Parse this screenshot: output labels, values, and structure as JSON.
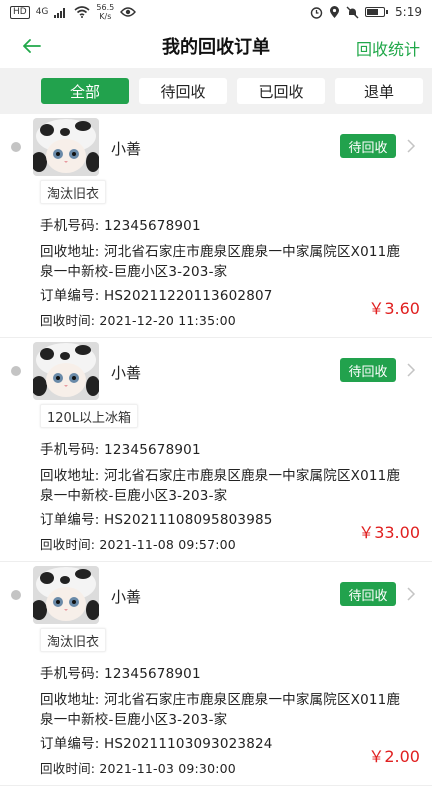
{
  "status_bar": {
    "hd": "HD",
    "signal": "4G",
    "speed_value": "56.5",
    "speed_unit": "K/s",
    "time": "5:19"
  },
  "header": {
    "title": "我的回收订单",
    "stats_label": "回收统计"
  },
  "tabs": [
    {
      "label": "全部",
      "active": true
    },
    {
      "label": "待回收",
      "active": false
    },
    {
      "label": "已回收",
      "active": false
    },
    {
      "label": "退单",
      "active": false
    }
  ],
  "labels": {
    "phone": "手机号码: ",
    "address": "回收地址: ",
    "order_no": "订单编号: ",
    "time": "回收时间: "
  },
  "orders": [
    {
      "username": "小善",
      "status": "待回收",
      "item": "淘汰旧衣",
      "phone": "12345678901",
      "address": "河北省石家庄市鹿泉区鹿泉一中家属院区X011鹿泉一中新校-巨鹿小区3-203-家",
      "order_no": "HS20211220113602807",
      "time": "2021-12-20 11:35:00",
      "amount": "￥3.60"
    },
    {
      "username": "小善",
      "status": "待回收",
      "item": "120L以上冰箱",
      "phone": "12345678901",
      "address": "河北省石家庄市鹿泉区鹿泉一中家属院区X011鹿泉一中新校-巨鹿小区3-203-家",
      "order_no": "HS20211108095803985",
      "time": "2021-11-08 09:57:00",
      "amount": "￥33.00"
    },
    {
      "username": "小善",
      "status": "待回收",
      "item": "淘汰旧衣",
      "phone": "12345678901",
      "address": "河北省石家庄市鹿泉区鹿泉一中家属院区X011鹿泉一中新校-巨鹿小区3-203-家",
      "order_no": "HS20211103093023824",
      "time": "2021-11-03 09:30:00",
      "amount": "￥2.00"
    }
  ],
  "colors": {
    "accent": "#22a24d",
    "amount": "#e02020",
    "tab_bar_bg": "#f1f1f1"
  },
  "icons": {
    "back": "arrow-left-icon",
    "chevron": "chevron-right-icon",
    "avatar": "cat-avatar-image"
  }
}
